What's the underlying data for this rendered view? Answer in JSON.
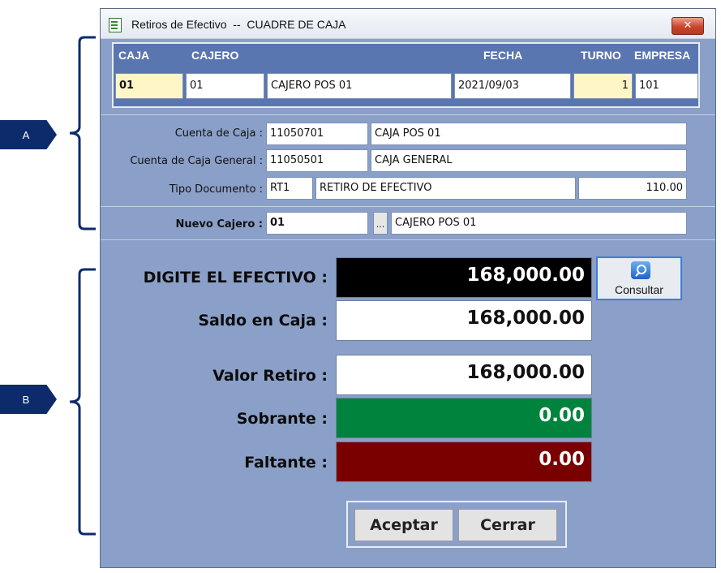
{
  "annotations": {
    "a": "A",
    "b": "B"
  },
  "window": {
    "title": "Retiros de Efectivo  --  CUADRE DE CAJA",
    "close_label": "✕"
  },
  "header": {
    "columns": [
      "CAJA",
      "CAJERO",
      "FECHA",
      "TURNO",
      "EMPRESA"
    ],
    "row": {
      "caja": "01",
      "cajero_code": "01",
      "cajero_name": "CAJERO POS 01",
      "fecha": "2021/09/03",
      "turno": "1",
      "empresa": "101"
    }
  },
  "form": {
    "cuenta_caja": {
      "label": "Cuenta de Caja :",
      "code": "11050701",
      "name": "CAJA POS 01"
    },
    "cuenta_caja_general": {
      "label": "Cuenta de Caja General :",
      "code": "11050501",
      "name": "CAJA GENERAL"
    },
    "tipo_documento": {
      "label": "Tipo Documento :",
      "code": "RT1",
      "name": "RETIRO DE EFECTIVO",
      "value": "110.00"
    },
    "nuevo_cajero": {
      "label": "Nuevo Cajero :",
      "code": "01",
      "browse": "...",
      "name": "CAJERO POS 01"
    }
  },
  "amounts": {
    "digite": {
      "label": "DIGITE EL EFECTIVO :",
      "value": "168,000.00"
    },
    "saldo": {
      "label": "Saldo en Caja :",
      "value": "168,000.00"
    },
    "retiro": {
      "label": "Valor Retiro :",
      "value": "168,000.00"
    },
    "sobrante": {
      "label": "Sobrante :",
      "value": "0.00"
    },
    "faltante": {
      "label": "Faltante :",
      "value": "0.00"
    }
  },
  "buttons": {
    "consultar": "Consultar",
    "aceptar": "Aceptar",
    "cerrar": "Cerrar"
  },
  "colors": {
    "window_bg": "#8aa0c8",
    "header_bg": "#5a76b0",
    "digite_bg": "#000000",
    "sobrante_bg": "#00843d",
    "faltante_bg": "#7a0000",
    "annotation": "#0d2b6b"
  }
}
